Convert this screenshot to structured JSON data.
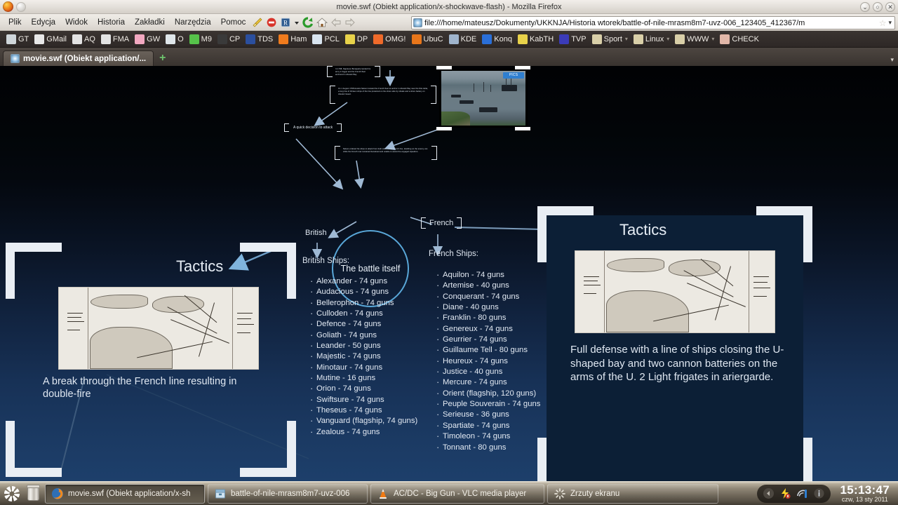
{
  "browser": {
    "window_title": "movie.swf (Obiekt application/x-shockwave-flash) - Mozilla Firefox",
    "window_buttons": [
      {
        "name": "minimize",
        "glyph": "⌄"
      },
      {
        "name": "maximize",
        "glyph": "○"
      },
      {
        "name": "close",
        "glyph": "✕"
      }
    ],
    "menus": [
      "Plik",
      "Edycja",
      "Widok",
      "Historia",
      "Zakładki",
      "Narzędzia",
      "Pomoc"
    ],
    "toolbar_icons": [
      "broom-icon",
      "adblock-icon",
      "readability-icon",
      "dropdown-caret-icon",
      "reload-icon",
      "home-icon",
      "back-icon",
      "forward-icon"
    ],
    "url": "file:///home/mateusz/Dokumenty/UKKNJA/Historia wtorek/battle-of-nile-mrasm8m7-uvz-006_123405_412367/m",
    "url_star": "☆",
    "url_caret": "▾",
    "bookmarks": [
      {
        "label": "GT",
        "color": "#cfd6da"
      },
      {
        "label": "GMail",
        "color": "#e8e8e8"
      },
      {
        "label": "AQ",
        "color": "#e3e3e3"
      },
      {
        "label": "FMA",
        "color": "#e3e3e3"
      },
      {
        "label": "GW",
        "color": "#f2a8c0"
      },
      {
        "label": "O",
        "color": "#dfe6ea"
      },
      {
        "label": "M9",
        "color": "#56c24a"
      },
      {
        "label": "CP",
        "color": "#3a3a3a"
      },
      {
        "label": "TDS",
        "color": "#2b4f9e"
      },
      {
        "label": "Ham",
        "color": "#f07b1d"
      },
      {
        "label": "PCL",
        "color": "#d8e4ef"
      },
      {
        "label": "DP",
        "color": "#e8d24a"
      },
      {
        "label": "OMG!",
        "color": "#ef6a2a"
      },
      {
        "label": "UbuC",
        "color": "#e8761a"
      },
      {
        "label": "KDE",
        "color": "#9fb4cc"
      },
      {
        "label": "Konq",
        "color": "#2a6fd8"
      },
      {
        "label": "KabTH",
        "color": "#e8d24a"
      },
      {
        "label": "TVP",
        "color": "#3b3bb8"
      },
      {
        "label": "Sport",
        "color": "#d9cfa8",
        "has_caret": true
      },
      {
        "label": "Linux",
        "color": "#d9cfa8",
        "has_caret": true
      },
      {
        "label": "WWW",
        "color": "#d9cfa8",
        "has_caret": true
      },
      {
        "label": "CHECK",
        "color": "#e2b7a8"
      }
    ],
    "tab_label": "movie.swf (Obiekt application/...",
    "newtab_glyph": "+",
    "tabbar_caret": "▾"
  },
  "prezi": {
    "center_node": "The battle itself",
    "branch_left_label": "British",
    "branch_right_label": "French",
    "quick_decision_label": "A quick decision to attack",
    "micro_texts": {
      "top": "In 1798, Napoleon Bonaparte landed his army in Egypt and the French fleet anchored in Aboukir Bay.",
      "mid": "On 1 August 1798 Horatio Nelson located the French fleet at anchor in Aboukir Bay near the Nile delta, a long line of thirteen ships of the line protected on the shore side by shoals and a shore battery on Aboukir Island.",
      "low": "Nelson ordered his ships to attack from both sides of the French line, doubling on the enemy van while the French rear remained becalmed and unable to assist the engaged squadron."
    },
    "photo_badge": "PICS",
    "british": {
      "heading": "British Ships:",
      "ships": [
        "Alexander - 74 guns",
        "Audacious - 74 guns",
        "Bellerophon - 74 guns",
        "Culloden - 74 guns",
        "Defence - 74 guns",
        "Goliath - 74 guns",
        "Leander - 50 guns",
        "Majestic - 74 guns",
        "Minotaur - 74 guns",
        "Mutine - 16 guns",
        "Orion - 74 guns",
        "Swiftsure - 74 guns",
        "Theseus - 74 guns",
        "Vanguard (flagship, 74 guns)",
        "Zealous - 74 guns"
      ]
    },
    "french": {
      "heading": "French Ships:",
      "ships": [
        "Aquilon - 74 guns",
        "Artemise - 40 guns",
        "Conquerant - 74 guns",
        "Diane - 40 guns",
        "Franklin - 80 guns",
        "Genereux - 74 guns",
        "Geurrier - 74 guns",
        "Guillaume Tell - 80 guns",
        "Heureux - 74 guns",
        "Justice - 40 guns",
        "Mercure - 74 guns",
        "Orient (flagship, 120 guns)",
        "Peuple Souverain - 74 guns",
        "Serieuse - 36 guns",
        "Spartiate - 74 guns",
        "Timoleon - 74 guns",
        "Tonnant - 80 guns"
      ]
    },
    "slide_left": {
      "title": "Tactics",
      "caption": "A break through the French line resulting in double-fire"
    },
    "slide_right": {
      "title": "Tactics",
      "caption": "Full defense with a line of ships closing the U-shaped bay and two cannon batteries on the arms of the U. 2 Light frigates in  ariergarde."
    }
  },
  "taskbar": {
    "system_icons": [
      "gear-icon",
      "trash-icon"
    ],
    "tasks": [
      {
        "label": "movie.swf (Obiekt application/x-sh",
        "icon": "firefox-icon",
        "active": true
      },
      {
        "label": "battle-of-nile-mrasm8m7-uvz-006",
        "icon": "archive-icon",
        "active": false
      },
      {
        "label": "AC/DC - Big Gun - VLC media player",
        "icon": "vlc-icon",
        "active": false
      },
      {
        "label": "Zrzuty ekranu",
        "icon": "busy-icon",
        "active": false
      }
    ],
    "tray_icons": [
      "tray-expand-icon",
      "power-icon",
      "network-icon",
      "info-icon"
    ],
    "clock_time": "15:13:47",
    "clock_date": "czw, 13 sty 2011"
  }
}
